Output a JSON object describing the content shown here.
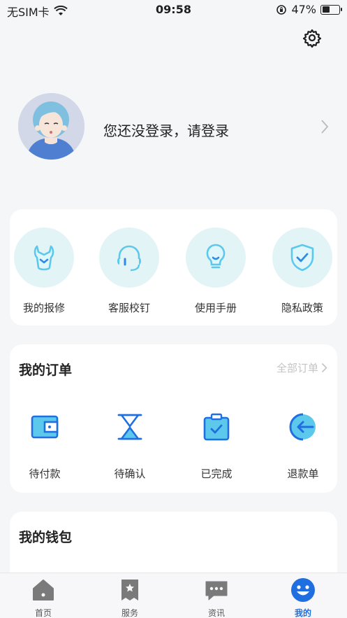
{
  "status_bar": {
    "carrier": "无SIM卡",
    "time": "09:58",
    "battery": "47%",
    "battery_level": 0.47
  },
  "profile": {
    "login_prompt": "您还没登录，请登录"
  },
  "quick_actions": [
    {
      "label": "我的报修",
      "icon": "wrench-icon"
    },
    {
      "label": "客服校钉",
      "icon": "headset-icon"
    },
    {
      "label": "使用手册",
      "icon": "lightbulb-icon"
    },
    {
      "label": "隐私政策",
      "icon": "shield-check-icon"
    }
  ],
  "orders": {
    "title": "我的订单",
    "all_label": "全部订单",
    "items": [
      {
        "label": "待付款",
        "icon": "wallet-icon"
      },
      {
        "label": "待确认",
        "icon": "hourglass-icon"
      },
      {
        "label": "已完成",
        "icon": "clipboard-check-icon"
      },
      {
        "label": "退款单",
        "icon": "refund-icon"
      }
    ]
  },
  "wallet": {
    "title": "我的钱包"
  },
  "tabbar": [
    {
      "label": "首页",
      "icon": "home-icon",
      "active": false
    },
    {
      "label": "服务",
      "icon": "service-icon",
      "active": false
    },
    {
      "label": "资讯",
      "icon": "chat-icon",
      "active": false
    },
    {
      "label": "我的",
      "icon": "profile-smile-icon",
      "active": true
    }
  ],
  "colors": {
    "accent": "#1f6fe0",
    "icon_blue": "#2d8be6",
    "icon_light": "#5cc8ec",
    "circle_bg": "#e3f4f7",
    "tab_gray": "#7a7a7a"
  }
}
